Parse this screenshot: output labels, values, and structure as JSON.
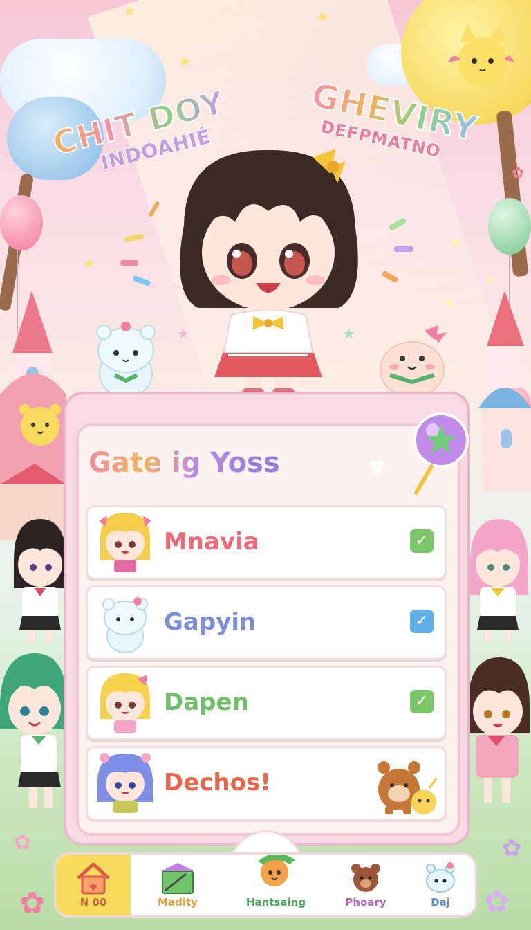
{
  "background": {
    "title_sticker_left": {
      "line1": "CHIT DOY",
      "line2": "INDOAHIÉ"
    },
    "title_sticker_right": {
      "line1": "GHEVIRY",
      "line2": "DEFPMATNO"
    }
  },
  "panel": {
    "title": "Gate ig Yoss",
    "rows": [
      {
        "name": "Mnavia",
        "checked": true,
        "color": "#ee6b7b",
        "check_color": "#7cc767"
      },
      {
        "name": "Gapyin",
        "checked": true,
        "color": "#7a8fd8",
        "check_color": "#5fb0e6"
      },
      {
        "name": "Dapen",
        "checked": true,
        "color": "#6fbf6a",
        "check_color": "#7cc767"
      },
      {
        "name": "Dechos!",
        "checked": false,
        "color": "#e8674a",
        "check_color": ""
      }
    ]
  },
  "nav": {
    "tabs": [
      {
        "label": "N 00",
        "icon": "house-icon",
        "active": true,
        "color": "#d1663e"
      },
      {
        "label": "Madity",
        "icon": "gift-box-icon",
        "active": false,
        "color": "#e9a23a"
      },
      {
        "label": "Hantsaing",
        "icon": "ranger-pet-icon",
        "active": false,
        "color": "#4aa85a"
      },
      {
        "label": "Phoary",
        "icon": "bear-icon",
        "active": false,
        "color": "#c061b8"
      },
      {
        "label": "Daj",
        "icon": "bunny-icon",
        "active": false,
        "color": "#5f8fd8"
      }
    ]
  },
  "colors": {
    "accent_pink": "#f18aa4",
    "panel_bg": "#fdf2ef",
    "nav_active": "#f7dc5c"
  }
}
